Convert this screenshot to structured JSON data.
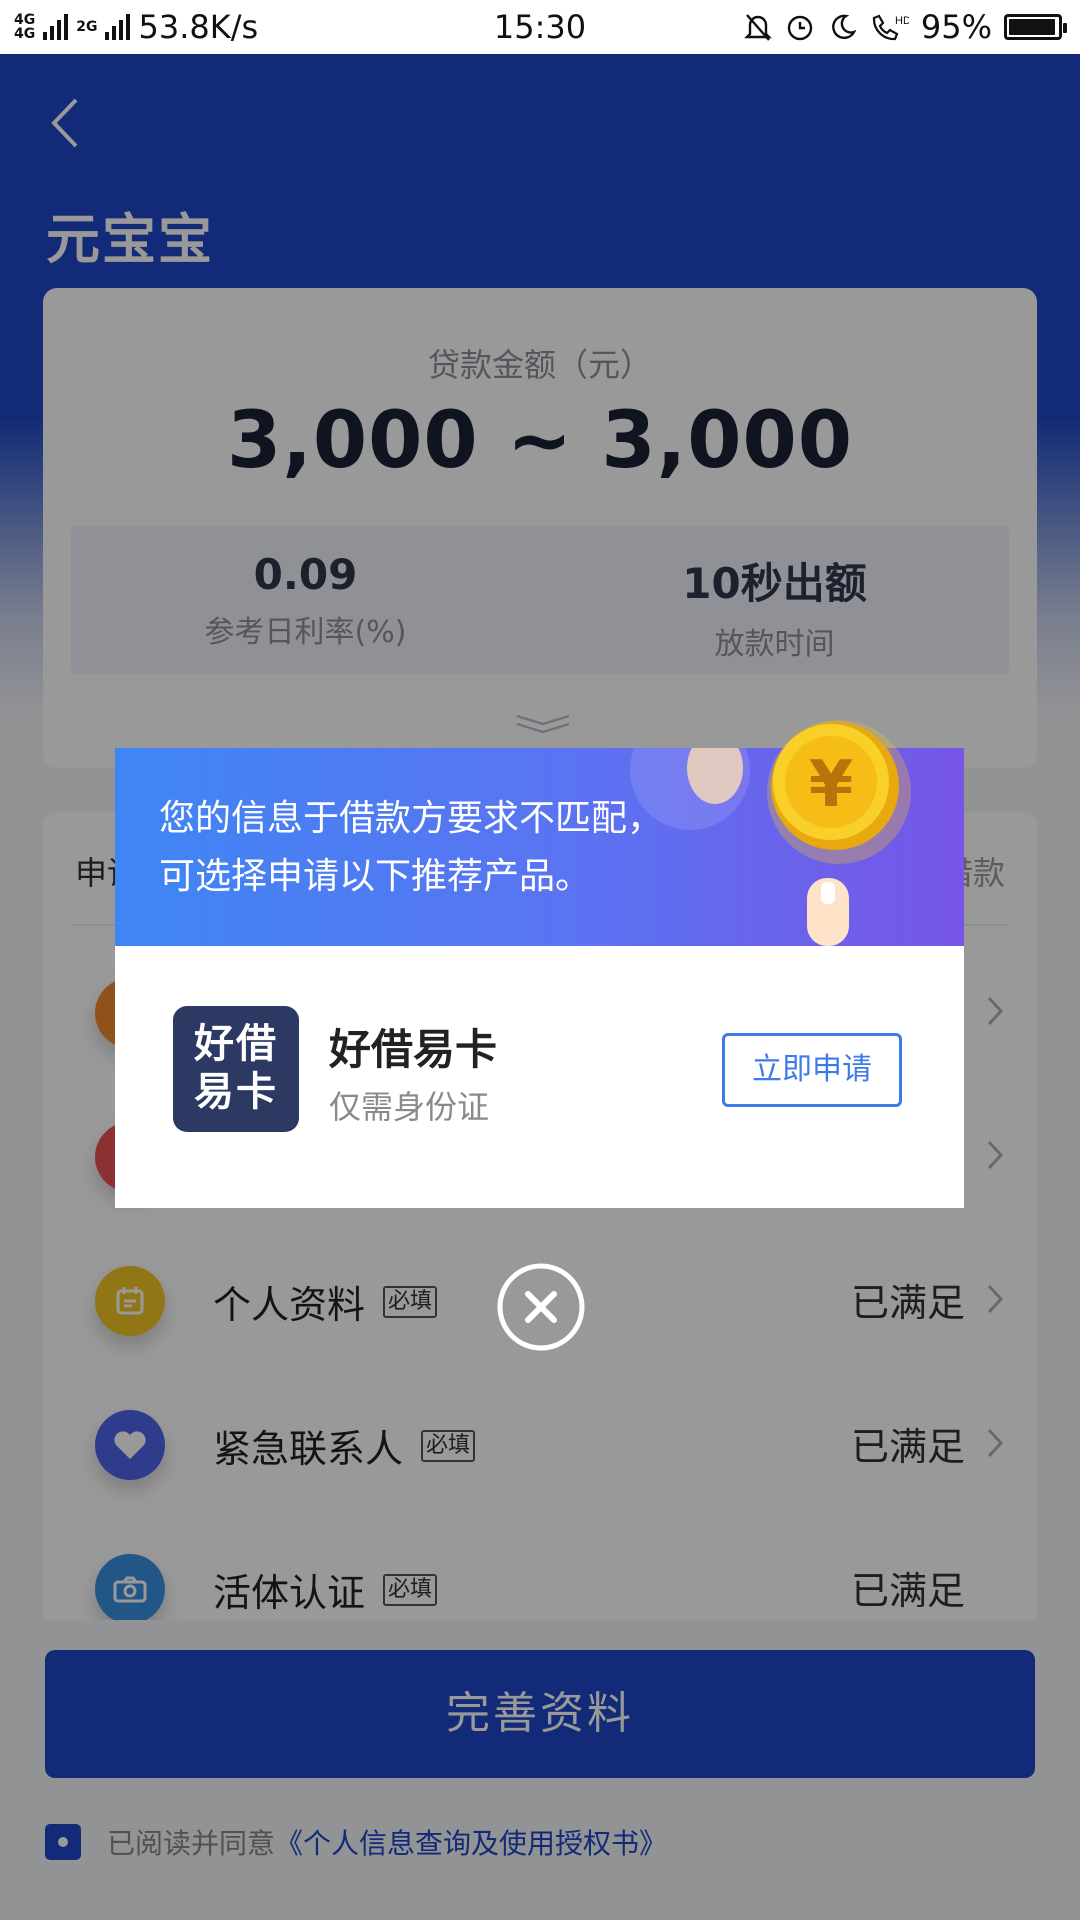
{
  "status_bar": {
    "network": "4G",
    "network2": "2G",
    "speed": "53.8K/s",
    "time": "15:30",
    "battery": "95%",
    "battery_level": 0.95,
    "icons": [
      "bell-muted-icon",
      "alarm-icon",
      "moon-icon",
      "hd-call-icon",
      "battery-icon"
    ]
  },
  "header": {
    "title": "元宝宝",
    "back_icon": "chevron-left-icon"
  },
  "loan": {
    "label": "贷款金额（元）",
    "range": "3,000 ~ 3,000",
    "rate_value": "0.09",
    "rate_label": "参考日利率(%)",
    "time_value": "10秒出额",
    "time_label": "放款时间"
  },
  "requirements": {
    "header_left": "申请条件",
    "header_right": "借款",
    "items": [
      {
        "name": "",
        "status": "",
        "icon": "id-icon",
        "color": "#f0892f"
      },
      {
        "name": "",
        "status": "",
        "icon": "card-icon",
        "color": "#e85252"
      },
      {
        "name": "个人资料",
        "badge": "必填",
        "status": "已满足",
        "icon": "calendar-icon",
        "color": "#f2c526"
      },
      {
        "name": "紧急联系人",
        "badge": "必填",
        "status": "已满足",
        "icon": "heart-icon",
        "color": "#4f65e8"
      },
      {
        "name": "活体认证",
        "badge": "必填",
        "status": "已满足",
        "icon": "camera-icon",
        "color": "#3a8fe0"
      }
    ]
  },
  "submit_button": "完善资料",
  "agreement": {
    "prefix": "已阅读并同意",
    "link": "《个人信息查询及使用授权书》"
  },
  "modal": {
    "message_line1": "您的信息于借款方要求不匹配，",
    "message_line2": "可选择申请以下推荐产品。",
    "coin_symbol": "¥",
    "product_logo_line1": "好借",
    "product_logo_line2": "易卡",
    "product_name": "好借易卡",
    "product_sub": "仅需身份证",
    "apply_label": "立即申请",
    "close_icon": "close-circle-icon"
  },
  "colors": {
    "primary": "#1f47c6",
    "accent_link": "#3f7be8",
    "banner_start": "#3f86f3",
    "banner_end": "#7755e6",
    "coin": "#f5c51f"
  }
}
